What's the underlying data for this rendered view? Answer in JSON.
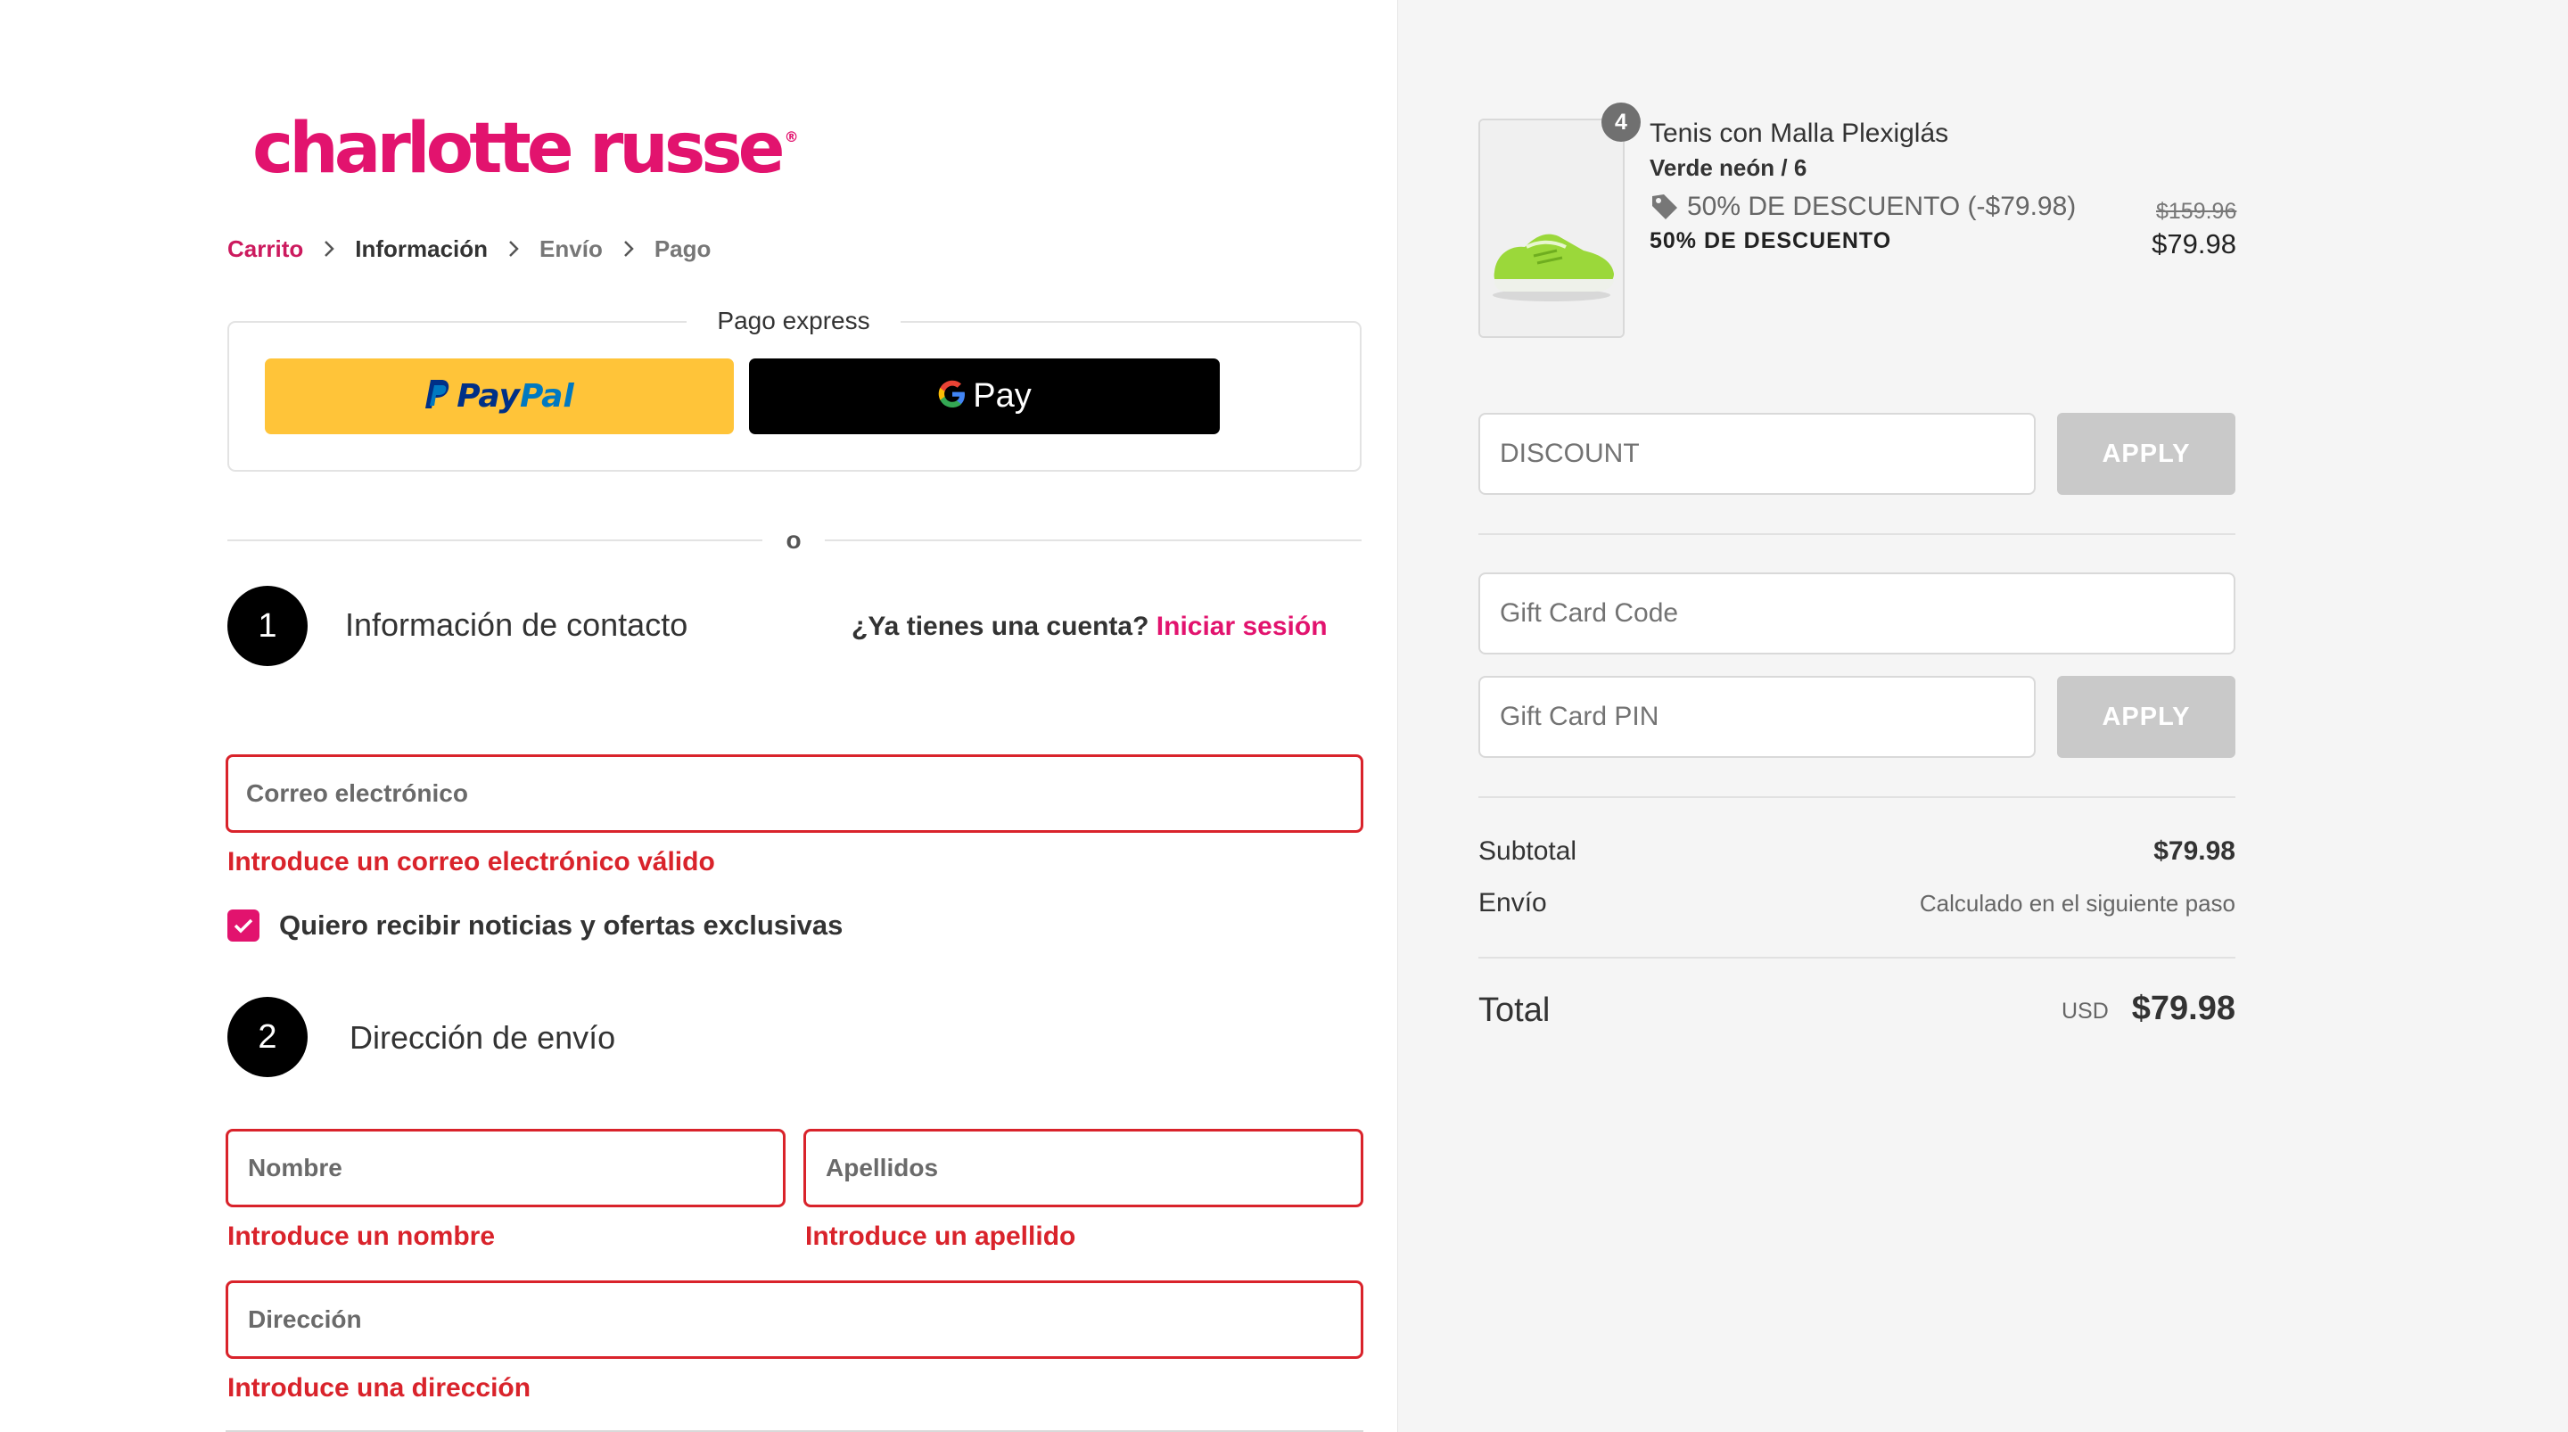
{
  "brand": {
    "name": "charlotte russe",
    "mark": "®"
  },
  "breadcrumb": [
    "Carrito",
    "Información",
    "Envío",
    "Pago"
  ],
  "express": {
    "legend": "Pago express",
    "paypal_label": "PayPal",
    "paypal_part1": "Pay",
    "paypal_part2": "Pal",
    "gpay_label": "Pay"
  },
  "divider_text": "o",
  "contact": {
    "step": "1",
    "title": "Información de contacto",
    "login_question": "¿Ya tienes una cuenta?",
    "login_link": "Iniciar sesión",
    "email_placeholder": "Correo electrónico",
    "email_error": "Introduce un correo electrónico válido",
    "newsletter_label": "Quiero recibir noticias y ofertas exclusivas",
    "newsletter_checked": true
  },
  "shipping": {
    "step": "2",
    "title": "Dirección de envío",
    "first_name_placeholder": "Nombre",
    "first_name_error": "Introduce un nombre",
    "last_name_placeholder": "Apellidos",
    "last_name_error": "Introduce un apellido",
    "address_placeholder": "Dirección",
    "address_error": "Introduce una dirección"
  },
  "cart": {
    "item": {
      "quantity": "4",
      "name": "Tenis con Malla Plexiglás",
      "variant": "Verde neón / 6",
      "discount_text": "50% DE DESCUENTO (-$79.98)",
      "discount_label": "50% DE DESCUENTO",
      "original_price": "$159.96",
      "price": "$79.98"
    },
    "discount_placeholder": "DISCOUNT",
    "apply_label": "APPLY",
    "gift_code_placeholder": "Gift Card Code",
    "gift_pin_placeholder": "Gift Card PIN",
    "subtotal_label": "Subtotal",
    "subtotal_value": "$79.98",
    "shipping_label": "Envío",
    "shipping_value": "Calculado en el siguiente paso",
    "total_label": "Total",
    "currency": "USD",
    "total_value": "$79.98"
  },
  "colors": {
    "brand": "#e2136e",
    "error": "#d9232b",
    "paypal": "#ffc439",
    "gpay": "#000000"
  }
}
